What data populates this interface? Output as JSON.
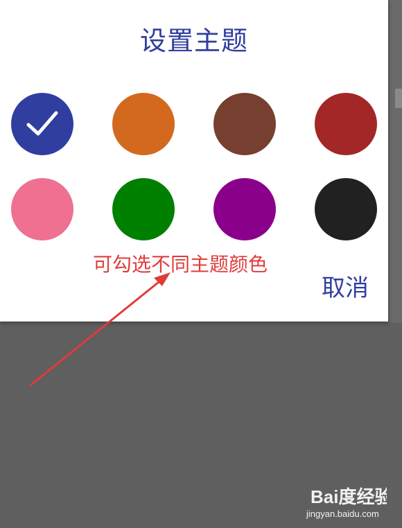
{
  "dialog": {
    "title": "设置主题",
    "cancel_label": "取消"
  },
  "swatches": [
    {
      "name": "blue",
      "color": "#303e9f",
      "selected": true
    },
    {
      "name": "orange",
      "color": "#d2691e"
    },
    {
      "name": "brown",
      "color": "#763f2f"
    },
    {
      "name": "red",
      "color": "#a32727"
    },
    {
      "name": "pink",
      "color": "#ef7090"
    },
    {
      "name": "green",
      "color": "#008000"
    },
    {
      "name": "purple",
      "color": "#8b008b"
    },
    {
      "name": "black",
      "color": "#212121"
    }
  ],
  "selected_icon": "check-icon",
  "annotation": {
    "text": "可勾选不同主题颜色",
    "color": "#e03b3b"
  },
  "watermark": {
    "logo_text": "Bai度经验",
    "url": "jingyan.baidu.com"
  },
  "colors": {
    "accent": "#303e9f",
    "backdrop": "#5f5f5f",
    "dialog_bg": "#ffffff"
  }
}
